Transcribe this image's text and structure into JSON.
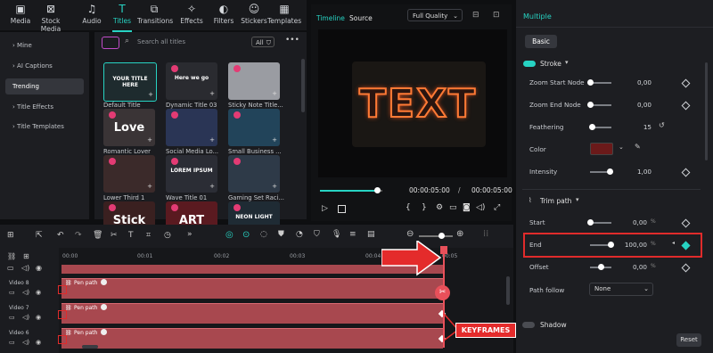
{
  "top_tabs": [
    {
      "label": "Media",
      "icon": "media-icon"
    },
    {
      "label": "Stock Media",
      "icon": "stock-media-icon"
    },
    {
      "label": "Audio",
      "icon": "audio-icon"
    },
    {
      "label": "Titles",
      "icon": "titles-icon",
      "active": true
    },
    {
      "label": "Transitions",
      "icon": "transitions-icon"
    },
    {
      "label": "Effects",
      "icon": "effects-icon"
    },
    {
      "label": "Filters",
      "icon": "filters-icon"
    },
    {
      "label": "Stickers",
      "icon": "stickers-icon"
    },
    {
      "label": "Templates",
      "icon": "templates-icon"
    }
  ],
  "sidebar": {
    "items": [
      {
        "label": "Mine"
      },
      {
        "label": "AI Captions"
      },
      {
        "label": "Trending",
        "active": true
      },
      {
        "label": "Title Effects"
      },
      {
        "label": "Title Templates"
      }
    ]
  },
  "library": {
    "search_placeholder": "Search all titles",
    "filter_label": "All",
    "cards": [
      {
        "label": "Default Title",
        "thumb": "YOUR TITLE HERE"
      },
      {
        "label": "Dynamic Title 03",
        "thumb": "Here we go"
      },
      {
        "label": "Sticky Note Title...",
        "thumb": ""
      },
      {
        "label": "Romantic Lover",
        "thumb": "Love"
      },
      {
        "label": "Social Media Lo...",
        "thumb": ""
      },
      {
        "label": "Small Business ...",
        "thumb": ""
      },
      {
        "label": "Lower Third 1",
        "thumb": ""
      },
      {
        "label": "Wave Title 01",
        "thumb": "LOREM IPSUM"
      },
      {
        "label": "Gaming Set Raci...",
        "thumb": ""
      },
      {
        "label": "",
        "thumb": "Stick"
      },
      {
        "label": "",
        "thumb": "ART"
      },
      {
        "label": "",
        "thumb": "NEON LIGHT"
      }
    ]
  },
  "preview": {
    "tab_timeline": "Timeline",
    "tab_source": "Source",
    "quality": "Full Quality",
    "preview_text": "TEXT",
    "time_current": "00:00:05:00",
    "time_separator": "/",
    "time_total": "00:00:05:00",
    "progress": 0.92
  },
  "properties": {
    "header": "Multiple",
    "tab_basic": "Basic",
    "stroke_label": "Stroke",
    "rows_top": [
      {
        "label": "Zoom Start Node",
        "value": "0,00",
        "level": 0.02
      },
      {
        "label": "Zoom End Node",
        "value": "0,00",
        "level": 0.02
      },
      {
        "label": "Feathering",
        "value": "15",
        "level": 0.1
      },
      {
        "label": "Color",
        "value": ""
      },
      {
        "label": "Intensity",
        "value": "1,00",
        "level": 0.9
      }
    ],
    "trim_label": "Trim path",
    "start": {
      "label": "Start",
      "value": "0,00",
      "unit": "%",
      "level": 0.02
    },
    "end": {
      "label": "End",
      "value": "100,00",
      "unit": "%",
      "level": 0.95
    },
    "offset": {
      "label": "Offset",
      "value": "0,00",
      "unit": "%",
      "level": 0.5
    },
    "path_follow": {
      "label": "Path follow",
      "value": "None"
    },
    "shadow_label": "Shadow",
    "reset_label": "Reset",
    "stroke_color": "#6b1a1a",
    "accent": "#27d3c3"
  },
  "timeline": {
    "ticks": [
      "00:00",
      "00:01",
      "00:02",
      "00:03",
      "00:04",
      "00:05"
    ],
    "tracks": [
      {
        "name": "Video 8",
        "clip": "Pen path"
      },
      {
        "name": "Video 7",
        "clip": "Pen path"
      },
      {
        "name": "Video 6",
        "clip": "Pen path"
      }
    ],
    "keyframes_label": "KEYFRAMES"
  }
}
